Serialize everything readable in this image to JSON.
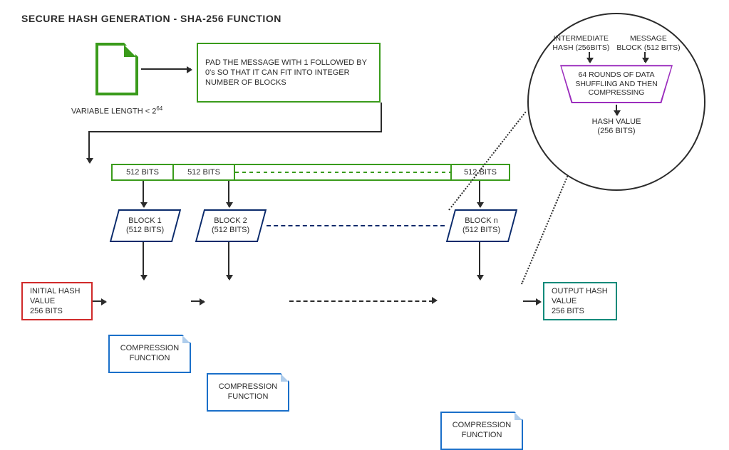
{
  "title": "SECURE HASH GENERATION - SHA-256 FUNCTION",
  "file": {
    "caption_prefix": "VARIABLE LENGTH < 2",
    "caption_exp": "64"
  },
  "pad_box": "PAD THE MESSAGE WITH 1 FOLLOWED BY 0's SO THAT IT CAN FIT INTO INTEGER NUMBER OF BLOCKS",
  "bits": {
    "b1": "512 BITS",
    "b2": "512 BITS",
    "bn": "512 BITS"
  },
  "blocks": {
    "b1": "BLOCK 1\n(512 BITS)",
    "b2": "BLOCK 2\n(512 BITS)",
    "bn": "BLOCK n\n(512 BITS)"
  },
  "comp": {
    "label": "COMPRESSION FUNCTION"
  },
  "init": "INITIAL HASH VALUE\n256 BITS",
  "output": "OUTPUT HASH VALUE\n256 BITS",
  "detail": {
    "left_top": "INTERMEDIATE",
    "left_bot": "HASH (256BITS)",
    "right_top": "MESSAGE",
    "right_bot": "BLOCK (512 BITS)",
    "trap": "64 ROUNDS OF DATA SHUFFLING AND THEN COMPRESSING",
    "hash": "HASH VALUE\n(256 BITS)"
  }
}
